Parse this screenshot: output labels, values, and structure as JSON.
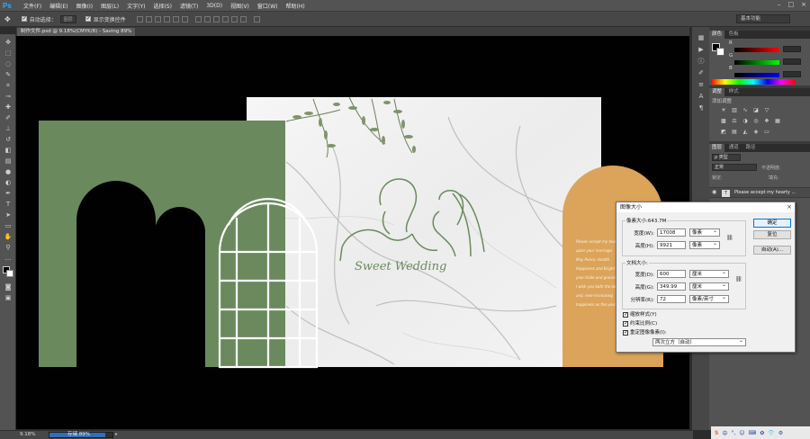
{
  "app": {
    "logo": "Ps"
  },
  "menu": [
    "文件(F)",
    "编辑(E)",
    "图像(I)",
    "图层(L)",
    "文字(Y)",
    "选择(S)",
    "滤镜(T)",
    "3D(D)",
    "视图(V)",
    "窗口(W)",
    "帮助(H)"
  ],
  "window_controls": [
    "–",
    "□",
    "×"
  ],
  "options": {
    "auto_select_label": "自动选择：",
    "auto_select_target": "图层",
    "show_transform_label": "显示变换控件",
    "workspace": "基本功能"
  },
  "document": {
    "tab_title": "制作文件.psd @ 9.18%(CMYK/8) - Saving 89%"
  },
  "status": {
    "zoom": "9.18%",
    "progress_label": "存储 89%",
    "progress": 0.89
  },
  "panels": {
    "color_tabs": [
      "颜色",
      "色板"
    ],
    "color_channels": [
      "R",
      "G",
      "B"
    ],
    "adjust_tabs": [
      "调整",
      "样式"
    ],
    "adjust_title": "添加调整",
    "layer_tabs": [
      "图层",
      "通道",
      "路径"
    ],
    "layer_filter": "ρ 类型",
    "blend_mode": "正常",
    "opacity_label": "不透明度:",
    "lock_label": "锁定:",
    "fill_label": "填充:",
    "layer_name": "Please accept my hearty ..."
  },
  "canvas": {
    "wedding_text": "Sweet Wedding",
    "orange_text_lines": [
      "Please accept my hear",
      "upon your marriage.",
      "May Peace, Health",
      "Happiness and Bright",
      "your bride and groom",
      "I wish you both the be",
      "and, ever-increasing",
      "happiness as the years"
    ]
  },
  "dialog": {
    "title": "图像大小",
    "close": "×",
    "pixel_dims_label": "像素大小:643.7M",
    "width_label": "宽度(W):",
    "width_px": "17008",
    "height_label": "高度(H):",
    "height_px": "9921",
    "pixel_unit": "像素",
    "doc_size_label": "文档大小:",
    "doc_width_label": "宽度(D):",
    "doc_width": "600",
    "doc_height_label": "高度(G):",
    "doc_height": "349.99",
    "cm_unit": "厘米",
    "resolution_label": "分辨率(R):",
    "resolution": "72",
    "resolution_unit": "像素/英寸",
    "ok": "确定",
    "reset": "复位",
    "auto": "自动(A)...",
    "scale_styles": "缩放样式(Y)",
    "constrain": "约束比例(C)",
    "resample": "重定图像像素(I):",
    "resample_method": "两次立方（自动）"
  },
  "tray": [
    "S",
    "中",
    "°,",
    "☺",
    "⌨",
    "✿",
    "👕",
    "⚙"
  ]
}
